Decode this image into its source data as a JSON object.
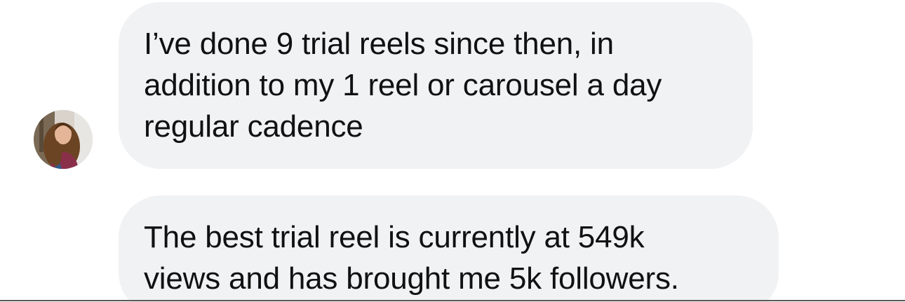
{
  "conversation": {
    "messages": [
      {
        "lines": [
          "I’ve done 9 trial reels since then, in",
          "addition to my 1 reel or carousel a day",
          "regular cadence"
        ]
      },
      {
        "lines": [
          "The best trial reel is currently at 549k",
          "views and has brought me 5k followers."
        ]
      }
    ],
    "avatar_icon": "user-avatar-photo"
  },
  "colors": {
    "bubble_background": "#f1f2f4",
    "text": "#111111",
    "page_background": "#ffffff"
  }
}
